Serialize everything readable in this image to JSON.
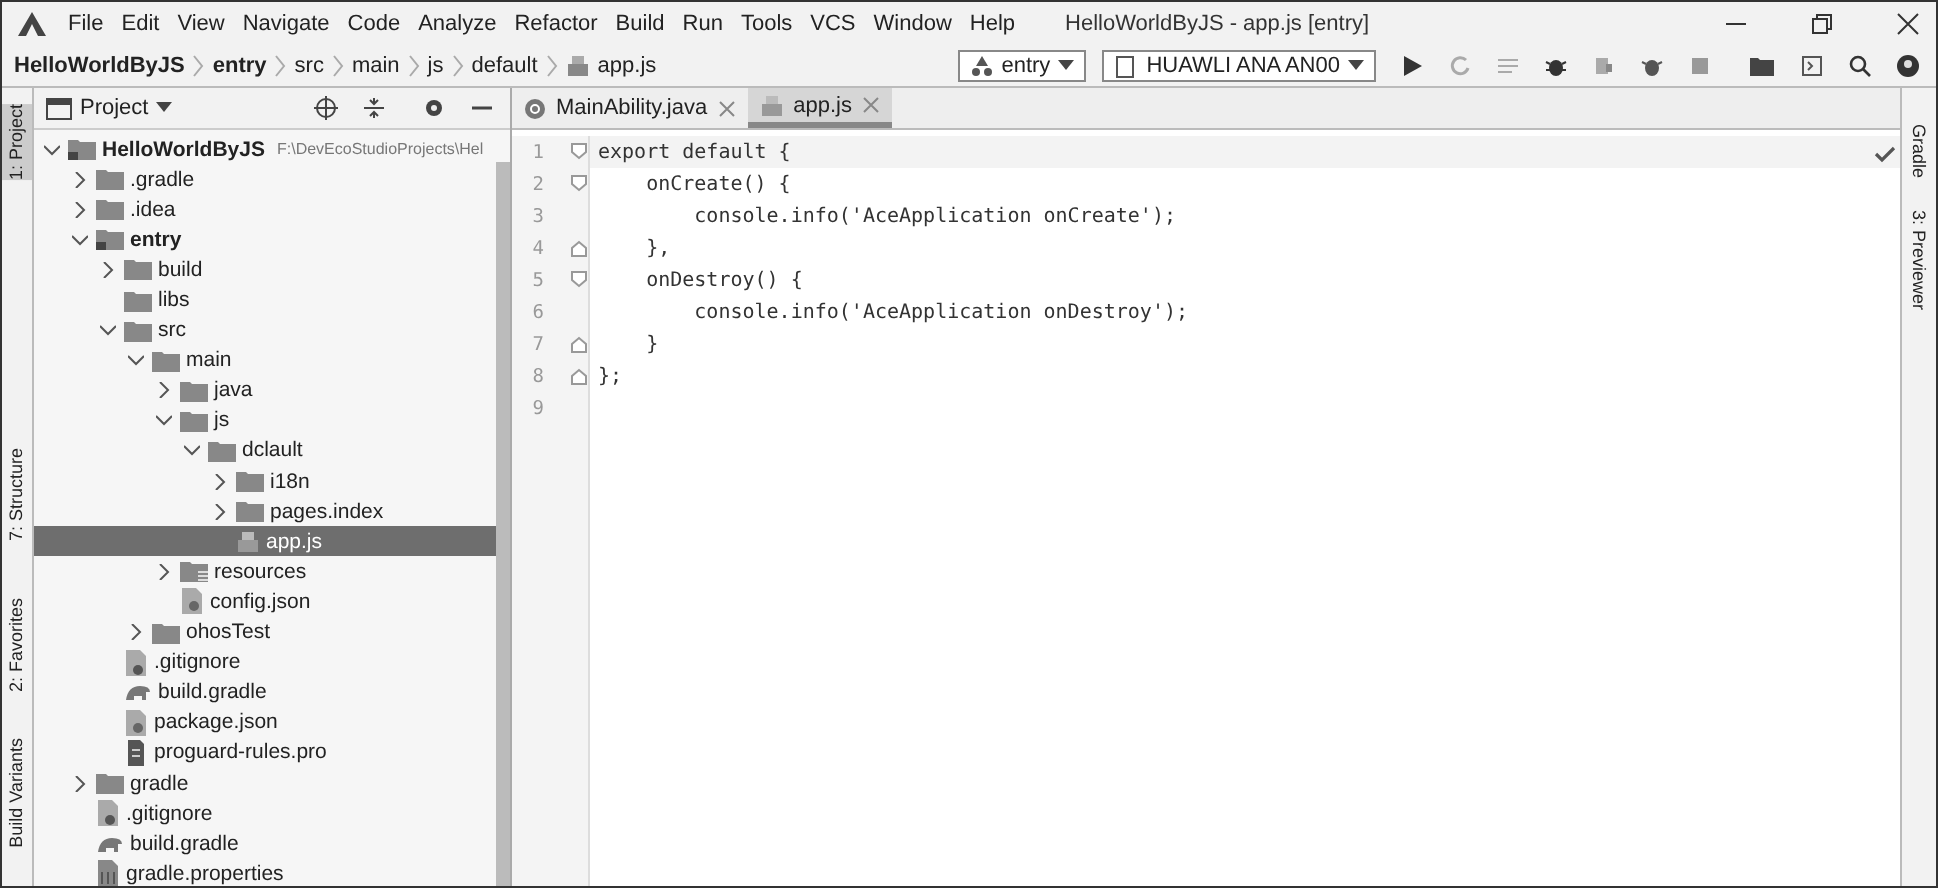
{
  "window": {
    "title": "HelloWorldByJS - app.js [entry]"
  },
  "menu": [
    "File",
    "Edit",
    "View",
    "Navigate",
    "Code",
    "Analyze",
    "Refactor",
    "Build",
    "Run",
    "Tools",
    "VCS",
    "Window",
    "Help"
  ],
  "breadcrumbs": [
    {
      "label": "HelloWorldByJS",
      "bold": true
    },
    {
      "label": "entry",
      "bold": true
    },
    {
      "label": "src",
      "bold": false
    },
    {
      "label": "main",
      "bold": false
    },
    {
      "label": "js",
      "bold": false
    },
    {
      "label": "default",
      "bold": false
    },
    {
      "label": "app.js",
      "bold": false
    }
  ],
  "toolbar": {
    "module": "entry",
    "device": "HUAWLI ANA AN00"
  },
  "left_strip": [
    {
      "label": "1: Project",
      "selected": true
    },
    {
      "label": "7: Structure",
      "selected": false
    },
    {
      "label": "2: Favorites",
      "selected": false
    },
    {
      "label": "Build Variants",
      "selected": false
    }
  ],
  "right_strip": [
    {
      "label": "Gradle",
      "selected": false
    },
    {
      "label": "3: Previewer",
      "selected": false
    }
  ],
  "project_panel": {
    "title": "Project",
    "tree": [
      {
        "label": "HelloWorldByJS",
        "path": "F:\\DevEcoStudioProjects\\Hel",
        "kind": "module",
        "expanded": true,
        "selected": false,
        "children": [
          {
            "label": ".gradle",
            "kind": "folder",
            "expanded": false,
            "selected": false
          },
          {
            "label": ".idea",
            "kind": "folder",
            "expanded": false,
            "selected": false
          },
          {
            "label": "entry",
            "kind": "module",
            "expanded": true,
            "selected": false,
            "children": [
              {
                "label": "build",
                "kind": "folder",
                "expanded": false,
                "selected": false
              },
              {
                "label": "libs",
                "kind": "folder",
                "selected": false
              },
              {
                "label": "src",
                "kind": "folder",
                "expanded": true,
                "selected": false,
                "children": [
                  {
                    "label": "main",
                    "kind": "folder",
                    "expanded": true,
                    "selected": false,
                    "children": [
                      {
                        "label": "java",
                        "kind": "folder",
                        "expanded": false,
                        "selected": false
                      },
                      {
                        "label": "js",
                        "kind": "folder",
                        "expanded": true,
                        "selected": false,
                        "children": [
                          {
                            "label": "dclault",
                            "kind": "folder",
                            "expanded": true,
                            "selected": false,
                            "children": [
                              {
                                "label": "i18n",
                                "kind": "folder",
                                "expanded": false,
                                "selected": false
                              },
                              {
                                "label": "pages.index",
                                "kind": "folder",
                                "expanded": false,
                                "selected": false
                              },
                              {
                                "label": "app.js",
                                "kind": "js",
                                "selected": true
                              }
                            ]
                          }
                        ]
                      },
                      {
                        "label": "resources",
                        "kind": "resources",
                        "expanded": false,
                        "selected": false
                      },
                      {
                        "label": "config.json",
                        "kind": "json",
                        "selected": false
                      }
                    ]
                  },
                  {
                    "label": "ohosTest",
                    "kind": "folder",
                    "expanded": false,
                    "selected": false
                  }
                ]
              },
              {
                "label": ".gitignore",
                "kind": "gitignore",
                "selected": false
              },
              {
                "label": "build.gradle",
                "kind": "gradle",
                "selected": false
              },
              {
                "label": "package.json",
                "kind": "json",
                "selected": false
              },
              {
                "label": "proguard-rules.pro",
                "kind": "text",
                "selected": false
              }
            ]
          },
          {
            "label": "gradle",
            "kind": "folder",
            "expanded": false,
            "selected": false
          },
          {
            "label": ".gitignore",
            "kind": "gitignore",
            "selected": false
          },
          {
            "label": "build.gradle",
            "kind": "gradle",
            "selected": false
          },
          {
            "label": "gradle.properties",
            "kind": "properties",
            "selected": false
          }
        ]
      }
    ]
  },
  "editor": {
    "tabs": [
      {
        "label": "MainAbility.java",
        "kind": "java",
        "selected": false
      },
      {
        "label": "app.js",
        "kind": "js",
        "selected": true
      }
    ],
    "lines": [
      {
        "number": "1",
        "text": "export default {",
        "fold_open": true,
        "fold_close": false
      },
      {
        "number": "2",
        "text": "    onCreate() {",
        "fold_open": true,
        "fold_close": false
      },
      {
        "number": "3",
        "text": "        console.info('AceApplication onCreate');",
        "fold_open": false,
        "fold_close": false
      },
      {
        "number": "4",
        "text": "    },",
        "fold_open": false,
        "fold_close": true
      },
      {
        "number": "5",
        "text": "    onDestroy() {",
        "fold_open": true,
        "fold_close": false
      },
      {
        "number": "6",
        "text": "        console.info('AceApplication onDestroy');",
        "fold_open": false,
        "fold_close": false
      },
      {
        "number": "7",
        "text": "    }",
        "fold_open": false,
        "fold_close": true
      },
      {
        "number": "8",
        "text": "};",
        "fold_open": false,
        "fold_close": true
      },
      {
        "number": "9",
        "fold_open": false,
        "fold_close": false
      }
    ]
  }
}
